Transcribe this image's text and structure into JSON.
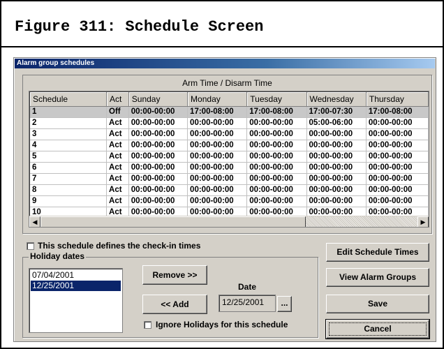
{
  "figure_title": "Figure 311: Schedule Screen",
  "window_title": "Alarm group schedules",
  "group_title": "Arm Time / Disarm Time",
  "table": {
    "columns": [
      "Schedule",
      "Act",
      "Sunday",
      "Monday",
      "Tuesday",
      "Wednesday",
      "Thursday"
    ],
    "rows": [
      [
        "1",
        "Off",
        "00:00-00:00",
        "17:00-08:00",
        "17:00-08:00",
        "17:00-07:30",
        "17:00-08:00"
      ],
      [
        "2",
        "Act",
        "00:00-00:00",
        "00:00-00:00",
        "00:00-00:00",
        "05:00-06:00",
        "00:00-00:00"
      ],
      [
        "3",
        "Act",
        "00:00-00:00",
        "00:00-00:00",
        "00:00-00:00",
        "00:00-00:00",
        "00:00-00:00"
      ],
      [
        "4",
        "Act",
        "00:00-00:00",
        "00:00-00:00",
        "00:00-00:00",
        "00:00-00:00",
        "00:00-00:00"
      ],
      [
        "5",
        "Act",
        "00:00-00:00",
        "00:00-00:00",
        "00:00-00:00",
        "00:00-00:00",
        "00:00-00:00"
      ],
      [
        "6",
        "Act",
        "00:00-00:00",
        "00:00-00:00",
        "00:00-00:00",
        "00:00-00:00",
        "00:00-00:00"
      ],
      [
        "7",
        "Act",
        "00:00-00:00",
        "00:00-00:00",
        "00:00-00:00",
        "00:00-00:00",
        "00:00-00:00"
      ],
      [
        "8",
        "Act",
        "00:00-00:00",
        "00:00-00:00",
        "00:00-00:00",
        "00:00-00:00",
        "00:00-00:00"
      ],
      [
        "9",
        "Act",
        "00:00-00:00",
        "00:00-00:00",
        "00:00-00:00",
        "00:00-00:00",
        "00:00-00:00"
      ],
      [
        "10",
        "Act",
        "00:00-00:00",
        "00:00-00:00",
        "00:00-00:00",
        "00:00-00:00",
        "00:00-00:00"
      ]
    ],
    "selected_row_index": 0
  },
  "checkin": {
    "label": "This schedule defines the check-in times",
    "checked": false
  },
  "holiday": {
    "title": "Holiday dates",
    "dates": [
      "07/04/2001",
      "12/25/2001"
    ],
    "selected_index": 1,
    "remove_label": "Remove >>",
    "add_label": "<< Add",
    "date_label": "Date",
    "date_value": "12/25/2001",
    "browse_label": "...",
    "ignore_label": "Ignore Holidays for this schedule",
    "ignore_checked": false
  },
  "buttons": {
    "edit": "Edit Schedule Times",
    "view": "View Alarm Groups",
    "save": "Save",
    "cancel": "Cancel"
  },
  "icons": {
    "scroll_left": "scroll-left-arrow-icon",
    "scroll_right": "scroll-right-arrow-icon"
  },
  "colors": {
    "window_face": "#d4d0c8",
    "titlebar": "#0a246a",
    "selection": "#0a246a"
  }
}
